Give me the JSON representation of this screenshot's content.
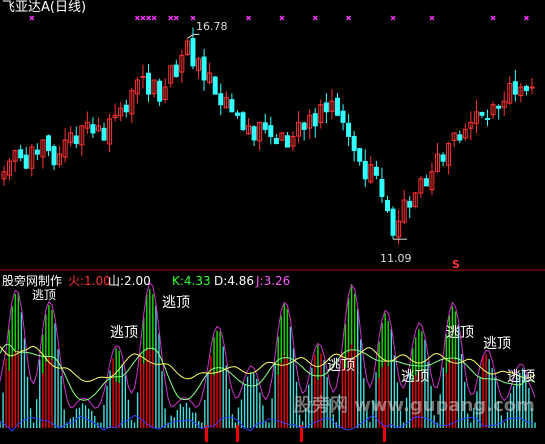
{
  "header": {
    "title": "飞亚达A",
    "period": "(日线)"
  },
  "indicator": {
    "name": "股旁网制作",
    "values": [
      {
        "label": "火:",
        "value": "1.00",
        "color": "#ff2b2b"
      },
      {
        "label": "山:",
        "value": "2.00",
        "color": "#ffffff"
      },
      {
        "label": "K:",
        "value": "4.33",
        "color": "#33ff33"
      },
      {
        "label": "D:",
        "value": "4.86",
        "color": "#ffffff"
      },
      {
        "label": "J:",
        "value": "3.26",
        "color": "#ff55ff"
      }
    ],
    "signal_text": "逃顶",
    "signal_partial": "逃顶"
  },
  "annotations": {
    "high": "16.78",
    "low": "11.09",
    "s_marker": "S"
  },
  "watermark": "股旁网 www.gupang.com",
  "colors": {
    "up": "#ff3333",
    "down": "#33ffff",
    "pink": "#ff33ff",
    "divider": "#b00000",
    "green": "#00dd00",
    "red": "#ee0000",
    "cyan": "#44dddd",
    "blue": "#3344ff",
    "yellow": "#ffff66"
  },
  "chart_data": [
    {
      "type": "candlestick",
      "title": "飞亚达A (日线)",
      "ylim": [
        10.5,
        17.3
      ],
      "annotated_high": 16.78,
      "annotated_low": 11.09,
      "closes": [
        13.0,
        13.3,
        13.6,
        13.4,
        13.1,
        13.7,
        13.5,
        13.9,
        13.6,
        13.2,
        13.5,
        13.9,
        14.1,
        13.8,
        14.3,
        14.4,
        14.1,
        14.3,
        13.9,
        14.5,
        14.6,
        14.8,
        14.7,
        15.3,
        15.6,
        15.7,
        15.2,
        15.6,
        15.0,
        15.4,
        16.0,
        15.7,
        16.3,
        16.7,
        16.0,
        16.2,
        15.6,
        15.8,
        15.2,
        14.9,
        15.1,
        14.7,
        14.6,
        14.2,
        14.3,
        13.9,
        14.4,
        14.2,
        14.0,
        13.8,
        14.1,
        13.7,
        14.0,
        14.4,
        14.2,
        14.6,
        14.3,
        14.9,
        14.7,
        15.0,
        14.6,
        14.4,
        14.0,
        13.6,
        13.3,
        12.8,
        13.2,
        12.9,
        12.3,
        11.9,
        11.2,
        11.6,
        12.2,
        12.0,
        12.4,
        12.8,
        12.6,
        13.0,
        13.5,
        13.3,
        13.8,
        14.1,
        13.9,
        14.2,
        14.4,
        14.7,
        14.6,
        14.5,
        14.9,
        14.8,
        15.0,
        15.5,
        15.2,
        15.4,
        15.3,
        15.4
      ],
      "pink_x_markers": [
        5,
        24,
        25,
        26,
        27,
        30,
        31,
        34,
        44,
        50,
        56,
        62,
        70,
        77,
        88,
        94
      ]
    },
    {
      "type": "bar",
      "title": "股旁网制作",
      "series": [
        {
          "name": "火",
          "value": 1.0
        },
        {
          "name": "山",
          "value": 2.0
        },
        {
          "name": "K",
          "value": 4.33
        },
        {
          "name": "D",
          "value": 4.86
        },
        {
          "name": "J",
          "value": 3.26
        }
      ],
      "peaks": [
        95,
        88,
        15,
        55,
        100,
        15,
        70,
        40,
        85,
        55,
        100,
        80,
        70,
        85,
        50,
        40
      ],
      "signal_positions": [
        4,
        20,
        28,
        61,
        73,
        81,
        88,
        92,
        96
      ]
    }
  ]
}
